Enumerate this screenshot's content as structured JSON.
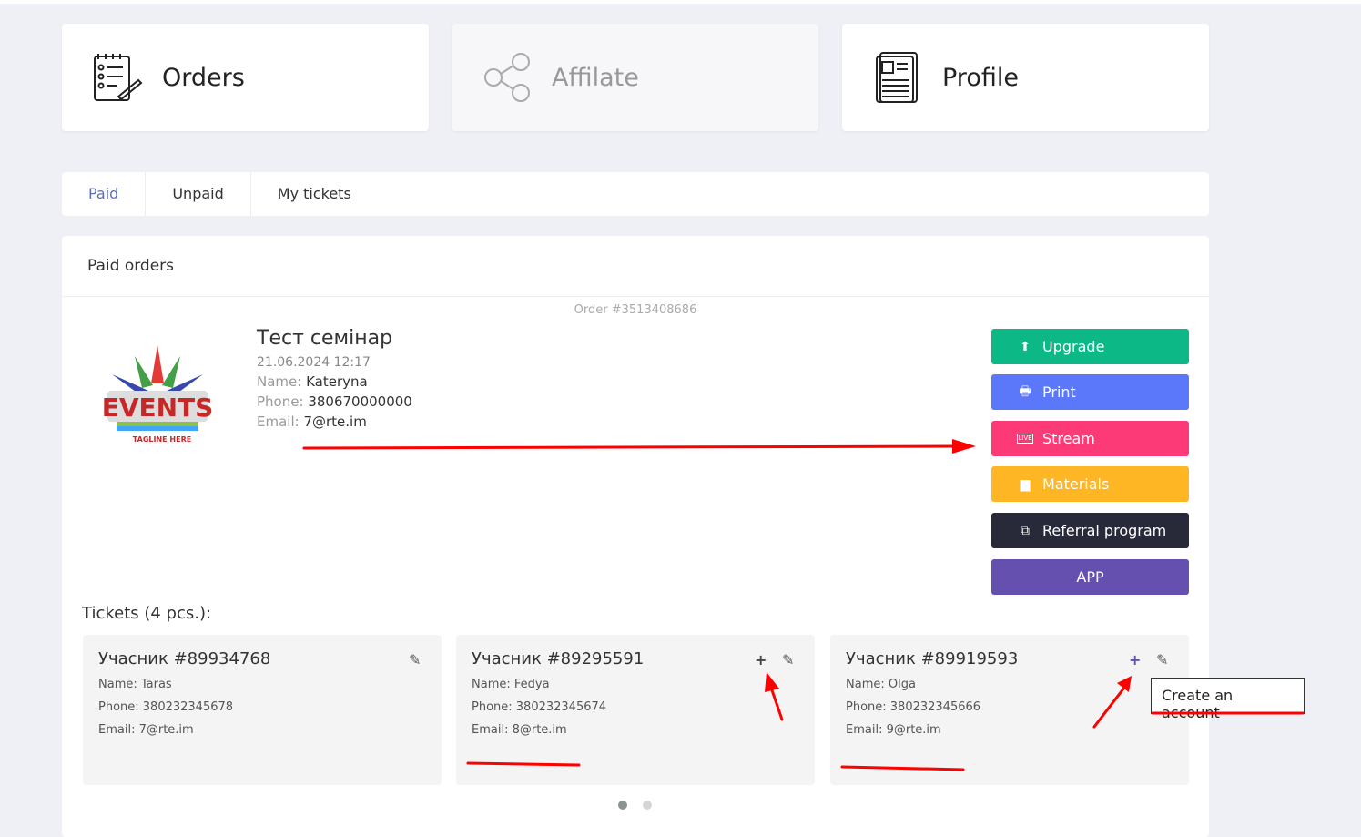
{
  "nav_cards": [
    {
      "label": "Orders",
      "icon": "orders-checklist-icon"
    },
    {
      "label": "Affilate",
      "icon": "affiliate-network-icon"
    },
    {
      "label": "Profile",
      "icon": "profile-document-icon"
    }
  ],
  "tabs": [
    {
      "label": "Paid",
      "active": true
    },
    {
      "label": "Unpaid"
    },
    {
      "label": "My tickets"
    }
  ],
  "panel": {
    "title": "Paid orders",
    "order": {
      "number": "Order #3513408686",
      "title": "Тест семінар",
      "date": "21.06.2024 12:17",
      "name_label": "Name:",
      "name": "Kateryna",
      "phone_label": "Phone:",
      "phone": "380670000000",
      "email_label": "Email:",
      "email": "7@rte.im"
    },
    "buttons": [
      {
        "label": "Upgrade",
        "color": "#0cb886",
        "icon": "arrow-up-icon"
      },
      {
        "label": "Print",
        "color": "#5b78fb",
        "icon": "printer-icon"
      },
      {
        "label": "Stream",
        "color": "#fd3a78",
        "icon": "live-icon"
      },
      {
        "label": "Materials",
        "color": "#feb624",
        "icon": "folder-icon"
      },
      {
        "label": "Referral program",
        "color": "#282a3a",
        "icon": "referral-puzzle-icon"
      },
      {
        "label": "APP",
        "color": "#6550af"
      }
    ],
    "tickets_label": "Tickets (4 pcs.):",
    "tickets": [
      {
        "title": "Учасник #89934768",
        "name": "Name: Taras",
        "phone": "Phone: 380232345678",
        "email": "Email: 7@rte.im"
      },
      {
        "title": "Учасник #89295591",
        "name": "Name: Fedya",
        "phone": "Phone: 380232345674",
        "email": "Email: 8@rte.im"
      },
      {
        "title": "Учасник #89919593",
        "name": "Name: Olga",
        "phone": "Phone: 380232345666",
        "email": "Email: 9@rte.im"
      }
    ],
    "tooltip": "Create an account",
    "carousel": {
      "pages": 2,
      "current": 1
    }
  }
}
